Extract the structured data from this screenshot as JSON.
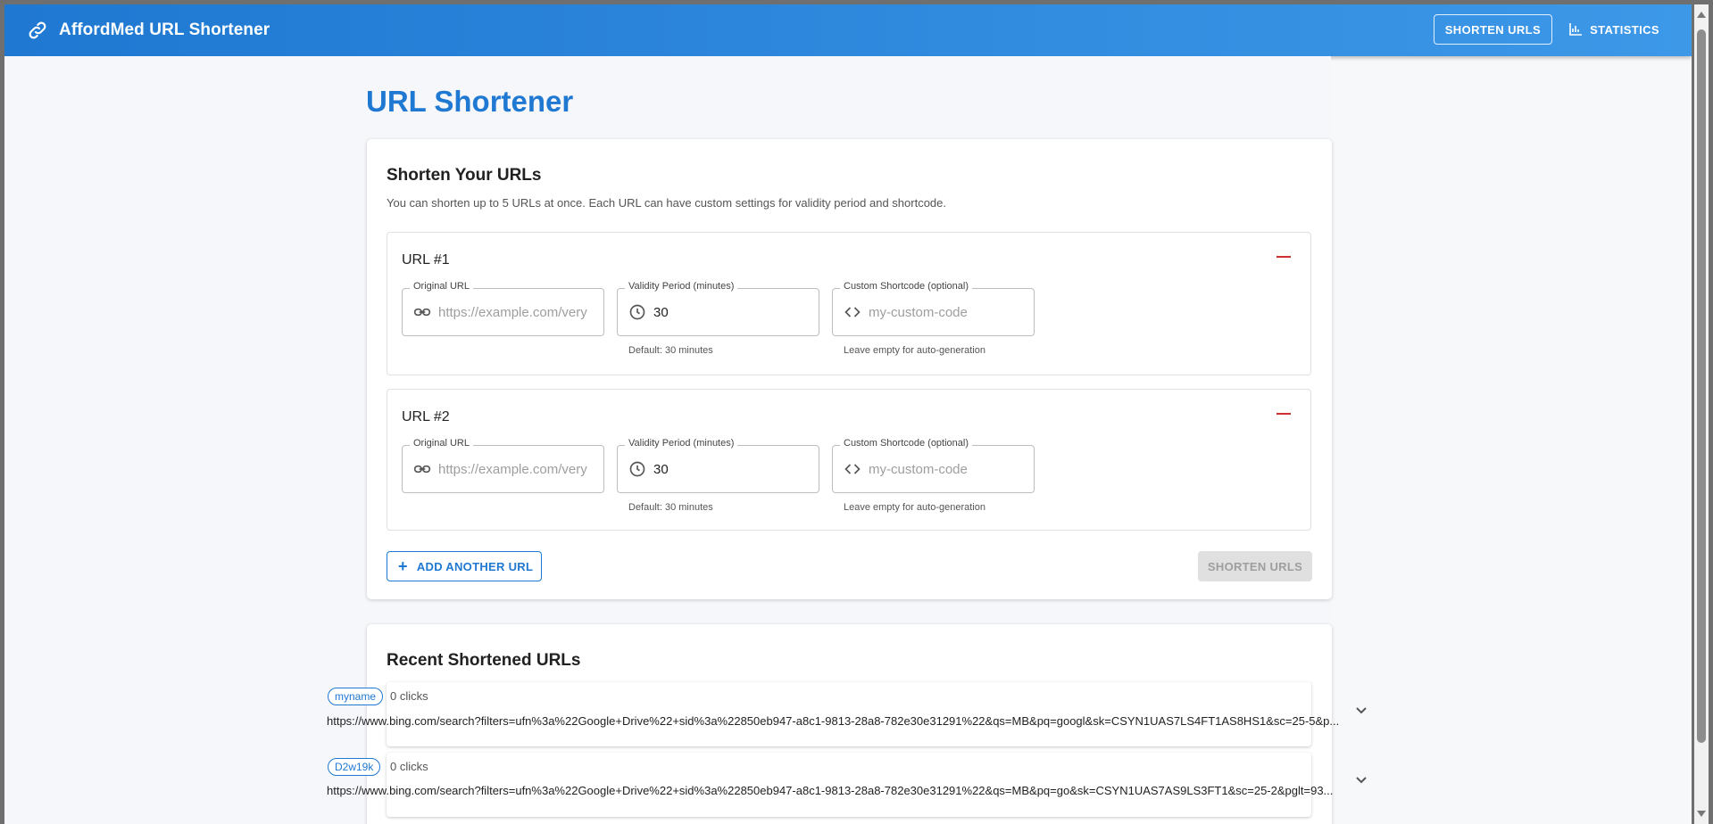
{
  "appbar": {
    "title": "AffordMed URL Shortener",
    "nav": {
      "shorten_label": "SHORTEN URLS",
      "stats_label": "STATISTICS"
    }
  },
  "page": {
    "title": "URL Shortener"
  },
  "shorten_card": {
    "title": "Shorten Your URLs",
    "description": "You can shorten up to 5 URLs at once. Each URL can have custom settings for validity period and shortcode.",
    "entries": [
      {
        "label": "URL #1",
        "original_url": {
          "legend": "Original URL",
          "placeholder": "https://example.com/very",
          "value": ""
        },
        "validity": {
          "legend": "Validity Period (minutes)",
          "value": "30",
          "helper": "Default: 30 minutes"
        },
        "shortcode": {
          "legend": "Custom Shortcode (optional)",
          "placeholder": "my-custom-code",
          "value": "",
          "helper": "Leave empty for auto-generation"
        }
      },
      {
        "label": "URL #2",
        "original_url": {
          "legend": "Original URL",
          "placeholder": "https://example.com/very",
          "value": ""
        },
        "validity": {
          "legend": "Validity Period (minutes)",
          "value": "30",
          "helper": "Default: 30 minutes"
        },
        "shortcode": {
          "legend": "Custom Shortcode (optional)",
          "placeholder": "my-custom-code",
          "value": "",
          "helper": "Leave empty for auto-generation"
        }
      }
    ],
    "add_label": "ADD ANOTHER URL",
    "submit_label": "SHORTEN URLS"
  },
  "recent": {
    "title": "Recent Shortened URLs",
    "items": [
      {
        "code": "myname",
        "clicks": "0 clicks",
        "url": "https://www.bing.com/search?filters=ufn%3a%22Google+Drive%22+sid%3a%22850eb947-a8c1-9813-28a8-782e30e31291%22&qs=MB&pq=googl&sk=CSYN1UAS7LS4FT1AS8HS1&sc=25-5&p..."
      },
      {
        "code": "D2w19k",
        "clicks": "0 clicks",
        "url": "https://www.bing.com/search?filters=ufn%3a%22Google+Drive%22+sid%3a%22850eb947-a8c1-9813-28a8-782e30e31291%22&qs=MB&pq=go&sk=CSYN1UAS7AS9LS3FT1&sc=25-2&pglt=93..."
      }
    ]
  },
  "colors": {
    "primary": "#1f78d1",
    "danger": "#d32f2f"
  },
  "icons": {
    "brand": "link-icon",
    "stats": "bar-chart-icon",
    "url_field": "link-icon",
    "validity_field": "clock-icon",
    "code_field": "code-icon",
    "add": "plus-icon",
    "remove": "minus-icon",
    "expand": "chevron-down-icon"
  }
}
